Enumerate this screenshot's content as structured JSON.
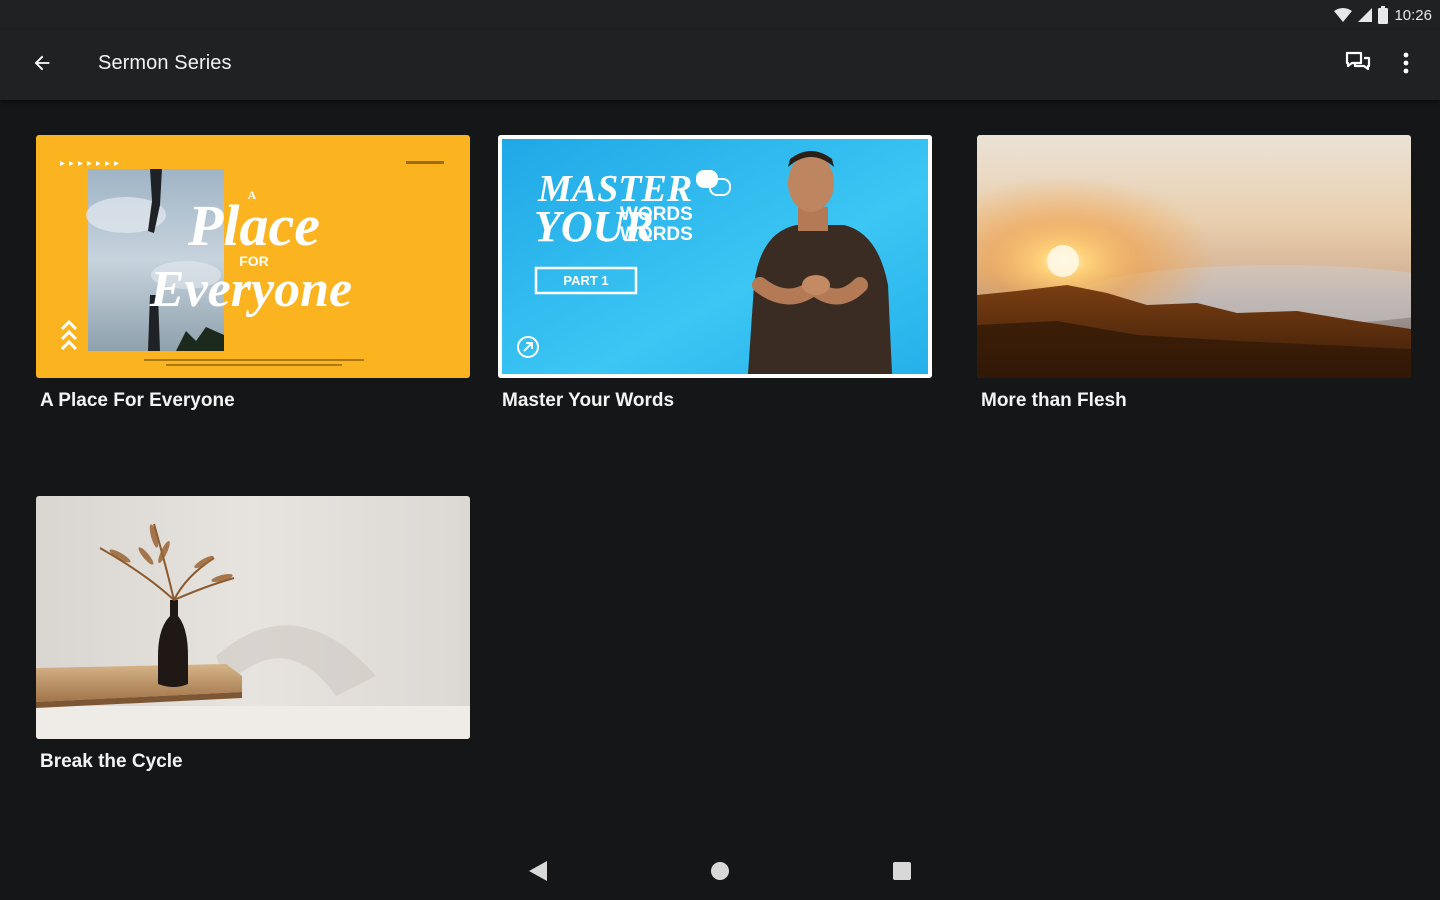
{
  "status_bar": {
    "time": "10:26",
    "icons": [
      "wifi-icon",
      "cell-signal-icon",
      "battery-icon"
    ]
  },
  "app_bar": {
    "title": "Sermon Series",
    "back_icon": "arrow-back-icon",
    "actions": [
      "chat-bubbles-icon",
      "more-vert-icon"
    ]
  },
  "series": [
    {
      "title": "A Place For Everyone",
      "artwork": {
        "line1": "A",
        "line2": "Place",
        "line3": "FOR",
        "line4": "Everyone",
        "accent": "#fbb41f"
      }
    },
    {
      "title": "Master Your Words",
      "artwork": {
        "line1": "MASTER",
        "line2": "YOUR",
        "line3": "WORDS",
        "line4": "WORDS",
        "badge": "PART 1",
        "accent": "#22b8ee"
      }
    },
    {
      "title": "More than Flesh",
      "artwork": {
        "accent": "#e08a2c"
      }
    },
    {
      "title": "Break the Cycle",
      "artwork": {
        "accent": "#e6e2dc"
      }
    }
  ],
  "nav_bar": {
    "buttons": [
      "nav-back-icon",
      "nav-home-icon",
      "nav-recents-icon"
    ]
  }
}
